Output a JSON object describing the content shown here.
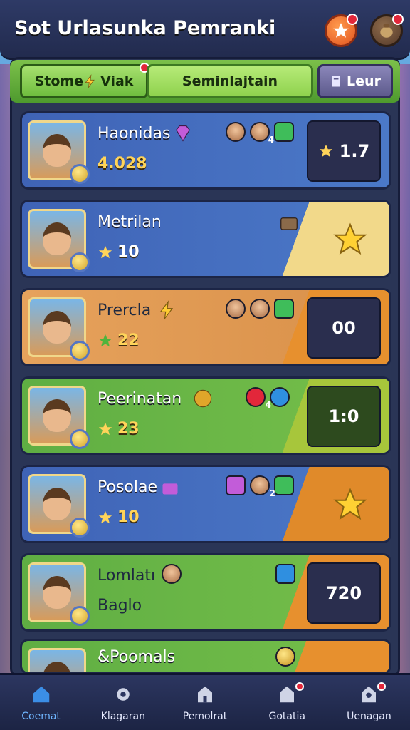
{
  "header": {
    "title": "Sot Urlasunka Pemranki"
  },
  "tabs": [
    {
      "label": "Stome",
      "label2": "Viak"
    },
    {
      "label": "Seminlajtain"
    },
    {
      "label": "Leur"
    }
  ],
  "players": [
    {
      "name": "Haonidas",
      "stat": "4.028",
      "score": "1.7"
    },
    {
      "name": "Metrilan",
      "stat": "10",
      "score": ""
    },
    {
      "name": "Prercla",
      "stat": "22",
      "score": "00"
    },
    {
      "name": "Peerinatan",
      "stat": "23",
      "score": "1:0"
    },
    {
      "name": "Posolae",
      "stat": "10",
      "score": ""
    },
    {
      "name": "Lomlatı",
      "stat": "Baglo",
      "score": "720"
    },
    {
      "name": "&Poomals",
      "stat": "",
      "score": ""
    }
  ],
  "mini_badges": {
    "c1": "4",
    "c4": "4",
    "c5": "2"
  },
  "bottom_nav": [
    {
      "label": "Coemat"
    },
    {
      "label": "Klagaran"
    },
    {
      "label": "Pemolrat"
    },
    {
      "label": "Gotatia"
    },
    {
      "label": "Uenagan"
    }
  ],
  "colors": {
    "accent_blue": "#4b79c8",
    "accent_orange": "#e7902e",
    "accent_green": "#6fbd3e",
    "gold": "#ffd45a"
  }
}
